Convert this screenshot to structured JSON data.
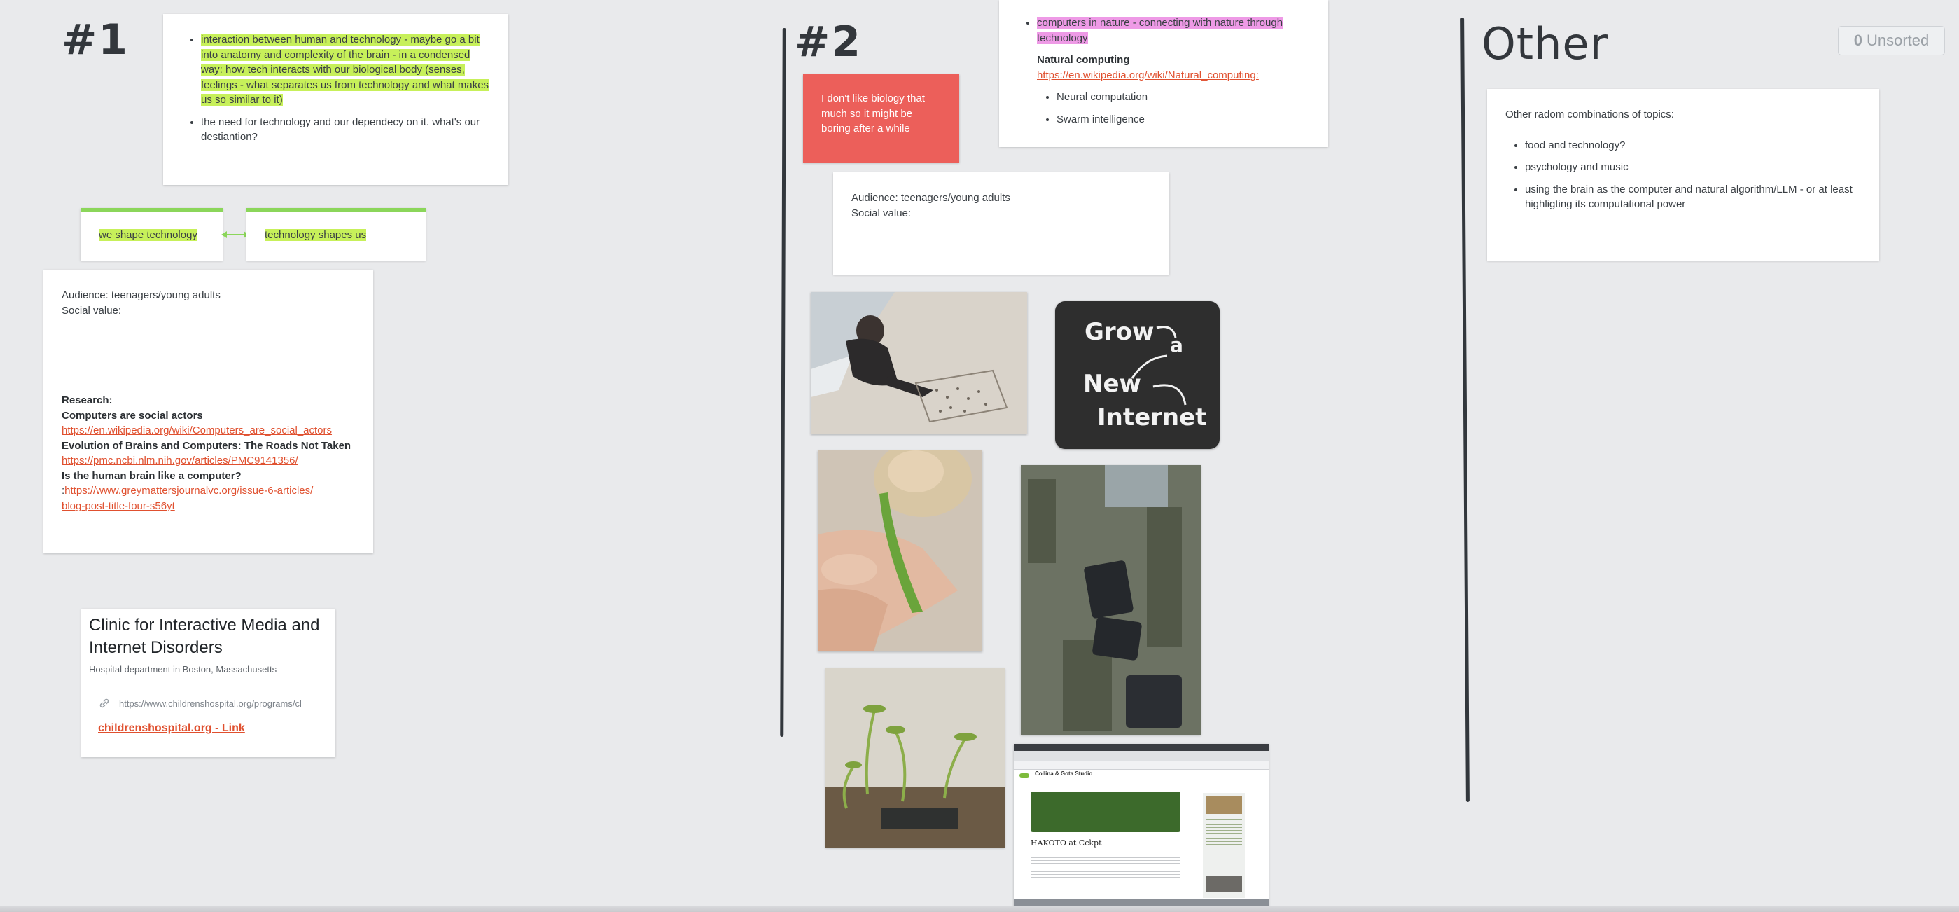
{
  "columns": {
    "col1_title": "#1",
    "col2_title": "#2",
    "col3_title": "Other"
  },
  "unsorted": {
    "count": "0",
    "label": "Unsorted"
  },
  "col1": {
    "note1": {
      "item1": "interaction between human and technology - maybe go a bit into anatomy and complexity of the brain - in a condensed way: how tech interacts with our biological body (senses, feelings - what separates us from technology and what makes us so similar to it)",
      "item2": "the need for technology and our dependecy on it. what's our destiantion?"
    },
    "tag_left": "we shape technology",
    "tag_right": "technology shapes us",
    "note2": {
      "audience": "Audience: teenagers/young adults",
      "social": "Social value:",
      "research": "Research:",
      "r1_title": "Computers are social actors",
      "r1_link": "https://en.wikipedia.org/wiki/Computers_are_social_actors",
      "r2_title": "Evolution of Brains and Computers: The Roads Not Taken",
      "r2_link": "https://pmc.ncbi.nlm.nih.gov/articles/PMC9141356/",
      "r3_title": "Is the human brain like a computer?",
      "r3_prefix": ":",
      "r3_link": "https://www.greymattersjournalvc.org/issue-6-articles/blog-post-title-four-s56yt"
    },
    "link_card": {
      "title": "Clinic for Interactive Media and Internet Disorders",
      "subtitle": "Hospital department in Boston, Massachusetts",
      "url": "https://www.childrenshospital.org/programs/cl",
      "link_label": "childrenshospital.org - Link"
    }
  },
  "col2": {
    "sticky": "I don't like biology that much so it might be boring after a while",
    "note1": {
      "item1": "computers in nature - connecting with nature through technology",
      "item2_title": "Natural computing",
      "item2_link": "https://en.wikipedia.org/wiki/Natural_computing:",
      "sub1": "Neural computation",
      "sub2": "Swarm intelligence"
    },
    "note2": {
      "audience": "Audience: teenagers/young adults",
      "social": "Social value:"
    },
    "grow_logo": {
      "w1": "Grow",
      "w2": "a",
      "w3": "New",
      "w4": "Internet"
    },
    "screenshot": {
      "brand": "Collina & Gota Studio",
      "heading": "HAKOTO at Cckpt"
    }
  },
  "col3": {
    "note": {
      "intro": "Other radom combinations of topics:",
      "item1": "food and technology?",
      "item2": "psychology and music",
      "item3": "using the brain as the computer and natural algorithm/LLM - or at least highligting its computational power"
    }
  },
  "colors": {
    "highlight_green": "#c7f05a",
    "highlight_pink": "#ee9ae6",
    "sticky_red": "#ec5f5a",
    "link_orange": "#e0502f",
    "connector_green": "#8bd65a"
  }
}
